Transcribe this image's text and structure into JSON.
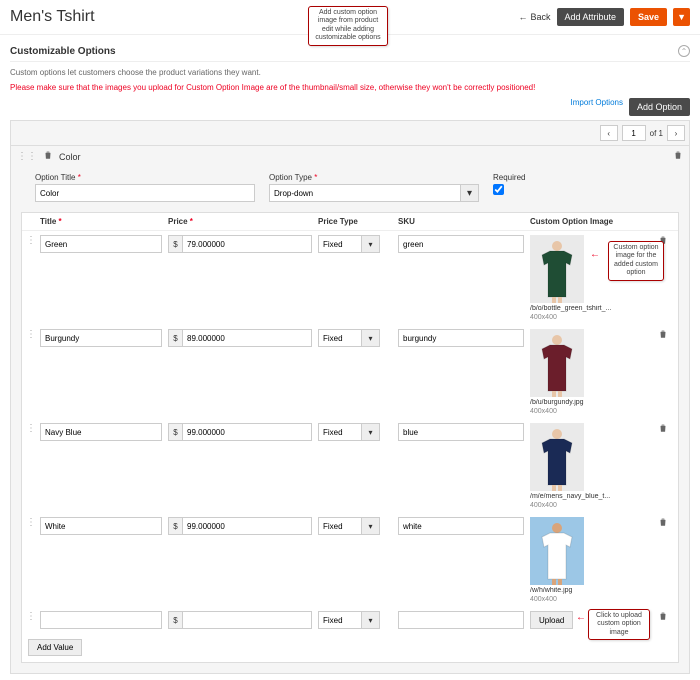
{
  "header": {
    "title": "Men's Tshirt",
    "back": "Back",
    "addAttribute": "Add Attribute",
    "save": "Save",
    "callout": "Add custom option image from product edit while adding customizable options"
  },
  "section": {
    "title": "Customizable Options",
    "desc": "Custom options let customers choose the product variations they want.",
    "warning": "Please make sure that the images you upload for Custom Option Image are of the thumbnail/small size, otherwise they won't be correctly positioned!",
    "importOptions": "Import Options",
    "addOption": "Add Option"
  },
  "pager": {
    "page": "1",
    "of": "of 1"
  },
  "option": {
    "nameLabel": "Color",
    "titleLabel": "Option Title",
    "titleValue": "Color",
    "typeLabel": "Option Type",
    "typeValue": "Drop-down",
    "requiredLabel": "Required"
  },
  "cols": {
    "title": "Title",
    "price": "Price",
    "ptype": "Price Type",
    "sku": "SKU",
    "img": "Custom Option Image"
  },
  "rows": [
    {
      "title": "Green",
      "price": "79.000000",
      "ptype": "Fixed",
      "sku": "green",
      "file": "/b/o/bottle_green_tshirt_...",
      "dim": "400x400",
      "color": "#1f4d34",
      "skin": "#e8c6a8"
    },
    {
      "title": "Burgundy",
      "price": "89.000000",
      "ptype": "Fixed",
      "sku": "burgundy",
      "file": "/b/u/burgundy.jpg",
      "dim": "400x400",
      "color": "#6b1e2b",
      "skin": "#e8c6a8"
    },
    {
      "title": "Navy Blue",
      "price": "99.000000",
      "ptype": "Fixed",
      "sku": "blue",
      "file": "/m/e/mens_navy_blue_t...",
      "dim": "400x400",
      "color": "#1a2a55",
      "skin": "#e8c6a8"
    },
    {
      "title": "White",
      "price": "99.000000",
      "ptype": "Fixed",
      "sku": "white",
      "file": "/w/h/white.jpg",
      "dim": "400x400",
      "color": "#ffffff",
      "skin": "#d9a47a",
      "bg": "#9cc7e6"
    }
  ],
  "emptyRow": {
    "ptype": "Fixed",
    "upload": "Upload"
  },
  "addValue": "Add Value",
  "annotations": {
    "imgCallout": "Custom option image for the added custom option",
    "uploadCallout": "Click to upload custom option image"
  }
}
